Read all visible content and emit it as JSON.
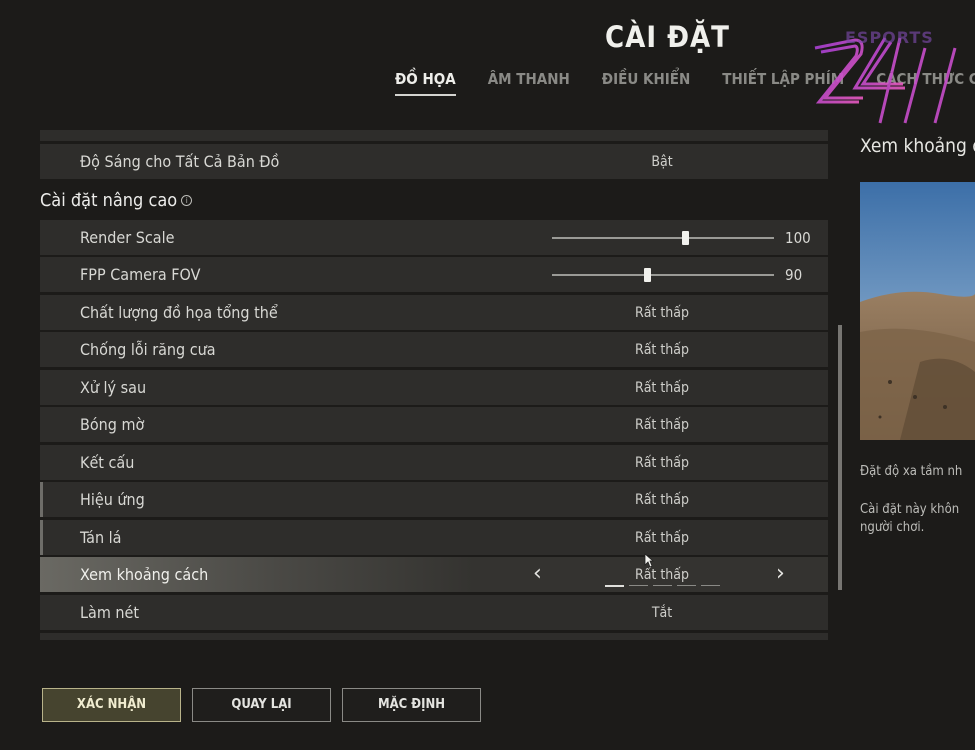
{
  "page_title": "CÀI ĐẶT",
  "tabs": [
    {
      "label": "ĐỒ HỌA",
      "active": true
    },
    {
      "label": "ÂM THANH",
      "active": false
    },
    {
      "label": "ĐIỀU KHIỂN",
      "active": false
    },
    {
      "label": "THIẾT LẬP PHÍM",
      "active": false
    },
    {
      "label": "CÁCH THỨC CHƠI",
      "active": false
    }
  ],
  "logo": {
    "text": "ESPORTS",
    "mark": "24H"
  },
  "settings": {
    "top_row": {
      "label": "Độ Sáng cho Tất Cả Bản Đồ",
      "value": "Bật"
    },
    "section_title": "Cài đặt nâng cao",
    "sliders": [
      {
        "label": "Render Scale",
        "value": "100",
        "level": 0.6
      },
      {
        "label": "FPP Camera FOV",
        "value": "90",
        "level": 0.43
      }
    ],
    "rows": [
      {
        "label": "Chất lượng đồ họa tổng thể",
        "value": "Rất thấp"
      },
      {
        "label": "Chống lỗi răng cưa",
        "value": "Rất thấp"
      },
      {
        "label": "Xử lý sau",
        "value": "Rất thấp"
      },
      {
        "label": "Bóng mờ",
        "value": "Rất thấp"
      },
      {
        "label": "Kết cấu",
        "value": "Rất thấp"
      },
      {
        "label": "Hiệu ứng",
        "value": "Rất thấp"
      },
      {
        "label": "Tán lá",
        "value": "Rất thấp"
      },
      {
        "label": "Xem khoảng cách",
        "value": "Rất thấp"
      },
      {
        "label": "Làm nét",
        "value": "Tắt"
      }
    ],
    "selected_level": 1,
    "level_count": 5
  },
  "side": {
    "title": "Xem khoảng c",
    "desc1": "Đặt độ xa tầm nh",
    "desc2_line1": "Cài đặt này khôn",
    "desc2_line2": "người chơi."
  },
  "buttons": {
    "confirm": "XÁC NHẬN",
    "back": "QUAY LẠI",
    "default": "MẶC ĐỊNH"
  },
  "colors": {
    "accent_button": "#46442f",
    "selected_row": "#6a6963"
  }
}
